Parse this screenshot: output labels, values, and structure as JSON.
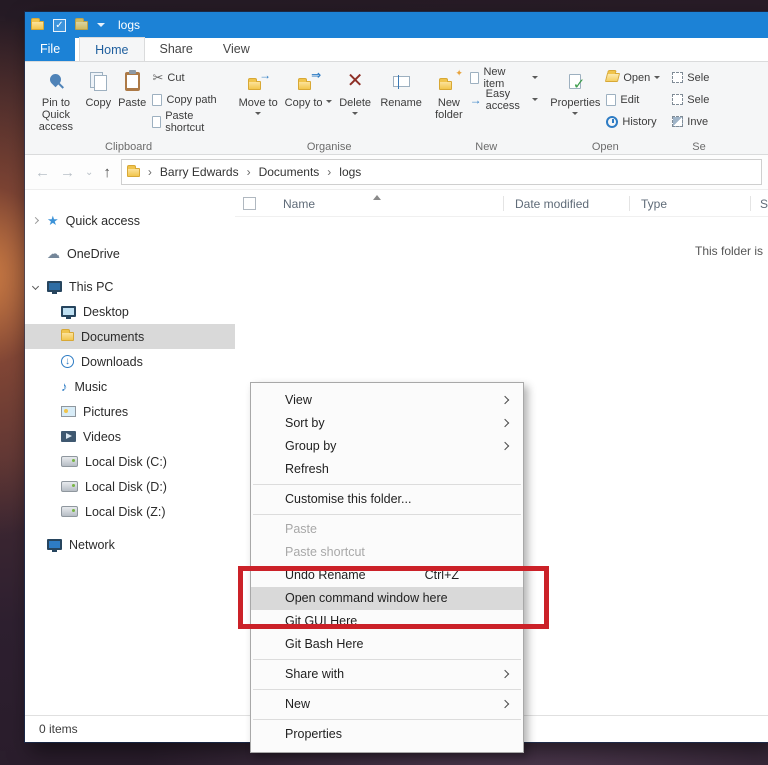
{
  "titlebar": {
    "title": "logs"
  },
  "tabs": {
    "file": "File",
    "home": "Home",
    "share": "Share",
    "view": "View"
  },
  "ribbon": {
    "clipboard": {
      "pin": "Pin to Quick access",
      "copy": "Copy",
      "paste": "Paste",
      "cut": "Cut",
      "copy_path": "Copy path",
      "paste_shortcut": "Paste shortcut",
      "group": "Clipboard"
    },
    "organise": {
      "move_to": "Move to",
      "copy_to": "Copy to",
      "delete": "Delete",
      "rename": "Rename",
      "group": "Organise"
    },
    "new": {
      "new_folder": "New folder",
      "new_item": "New item",
      "easy_access": "Easy access",
      "group": "New"
    },
    "open": {
      "properties": "Properties",
      "open": "Open",
      "edit": "Edit",
      "history": "History",
      "group": "Open"
    },
    "select": {
      "select_all": "Sele",
      "select_none": "Sele",
      "invert": "Inve",
      "group": "Se"
    }
  },
  "address": {
    "crumbs": [
      "Barry Edwards",
      "Documents",
      "logs"
    ],
    "separator": "›"
  },
  "sidebar": {
    "items": [
      {
        "label": "Quick access"
      },
      {
        "label": "OneDrive"
      },
      {
        "label": "This PC"
      },
      {
        "label": "Desktop"
      },
      {
        "label": "Documents"
      },
      {
        "label": "Downloads"
      },
      {
        "label": "Music"
      },
      {
        "label": "Pictures"
      },
      {
        "label": "Videos"
      },
      {
        "label": "Local Disk (C:)"
      },
      {
        "label": "Local Disk (D:)"
      },
      {
        "label": "Local Disk (Z:)"
      },
      {
        "label": "Network"
      }
    ]
  },
  "files": {
    "columns": {
      "name": "Name",
      "date": "Date modified",
      "type": "Type",
      "size": "S"
    },
    "empty": "This folder is"
  },
  "context_menu": {
    "items": [
      {
        "label": "View"
      },
      {
        "label": "Sort by"
      },
      {
        "label": "Group by"
      },
      {
        "label": "Refresh"
      },
      {
        "label": "Customise this folder..."
      },
      {
        "label": "Paste"
      },
      {
        "label": "Paste shortcut"
      },
      {
        "label": "Undo Rename",
        "shortcut": "Ctrl+Z"
      },
      {
        "label": "Open command window here"
      },
      {
        "label": "Git GUI Here"
      },
      {
        "label": "Git Bash Here"
      },
      {
        "label": "Share with"
      },
      {
        "label": "New"
      },
      {
        "label": "Properties"
      }
    ]
  },
  "status": {
    "count": "0 items"
  }
}
